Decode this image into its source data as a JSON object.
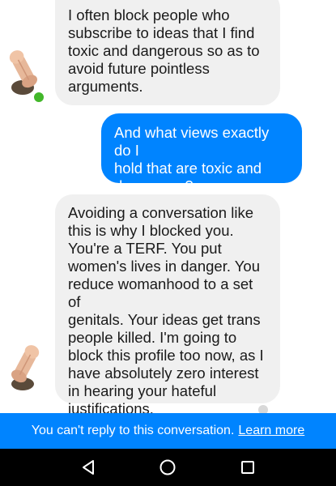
{
  "messages": [
    {
      "id": "msg1",
      "direction": "incoming",
      "text": "I often block people who\nsubscribe to ideas that I find\ntoxic and dangerous so as to\navoid future pointless\narguments."
    },
    {
      "id": "msg2",
      "direction": "outgoing",
      "text": "And what views exactly do I\nhold that are toxic and\ndangerous?"
    },
    {
      "id": "msg3",
      "direction": "incoming",
      "text": "Avoiding a conversation like\nthis is why I blocked you.\nYou're a TERF. You put\nwomen's lives in danger. You\nreduce womanhood to a set of\ngenitals. Your ideas get trans\npeople killed. I'm going to\nblock this profile too now, as I\nhave absolutely zero interest\nin hearing your hateful\njustifications."
    }
  ],
  "reply_bar": {
    "notice": "You can't reply to this conversation.",
    "link": "Learn more"
  },
  "colors": {
    "outgoing_bubble": "#0084ff",
    "incoming_bubble": "#f0f0f0",
    "reply_bar": "#0084ff",
    "online_indicator": "#42b72a"
  },
  "icons": {
    "avatar": "contact-avatar-icon",
    "nav_back": "triangle-back-icon",
    "nav_home": "circle-home-icon",
    "nav_recents": "square-recents-icon"
  }
}
